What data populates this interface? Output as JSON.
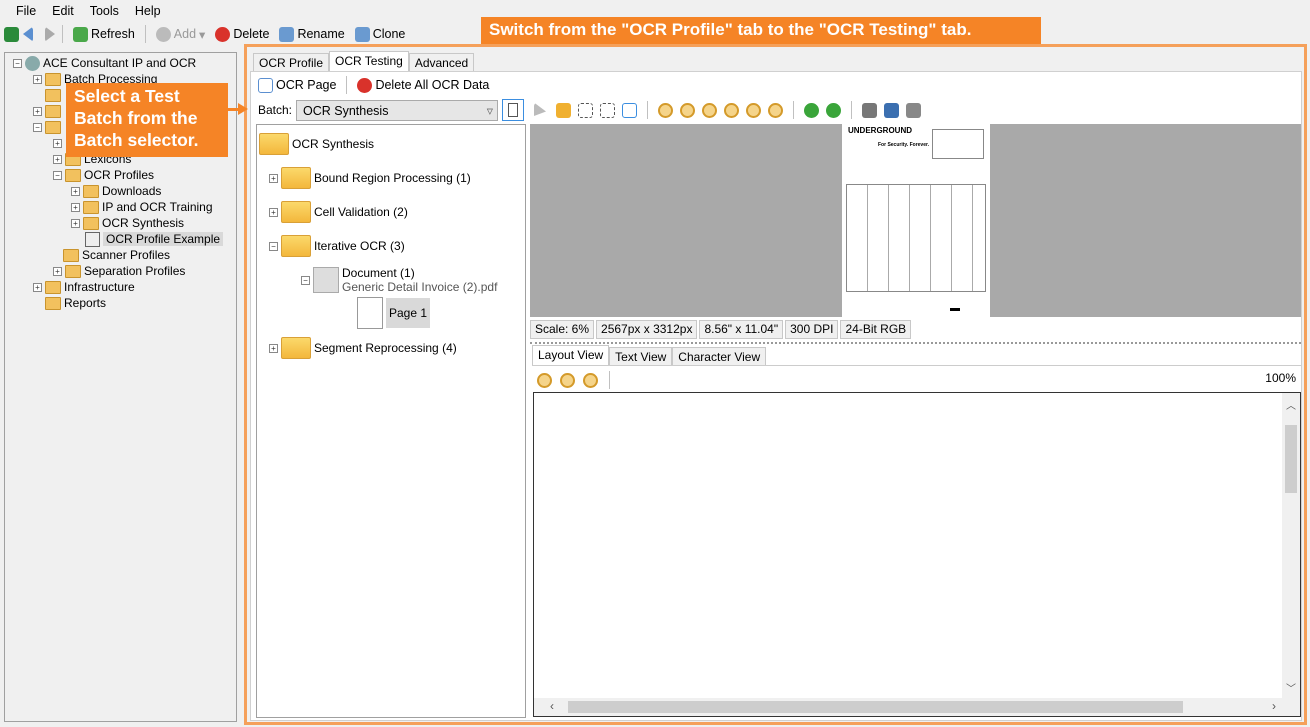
{
  "menu": [
    "File",
    "Edit",
    "Tools",
    "Help"
  ],
  "toolbar": {
    "refresh": "Refresh",
    "add": "Add",
    "delete": "Delete",
    "rename": "Rename",
    "clone": "Clone"
  },
  "tree": {
    "root": "ACE Consultant IP and OCR",
    "items": [
      "Batch Processing",
      "Lexicons",
      "OCR Profiles",
      "Downloads",
      "IP and OCR Training",
      "OCR Synthesis",
      "OCR Profile Example",
      "Scanner Profiles",
      "Separation Profiles",
      "Infrastructure",
      "Reports"
    ]
  },
  "callouts": {
    "top": "Switch from the \"OCR Profile\" tab to the \"OCR Testing\" tab.",
    "left": "Select a Test Batch from the Batch selector."
  },
  "tabs": [
    "OCR Profile",
    "OCR Testing",
    "Advanced"
  ],
  "active_tab": "OCR Testing",
  "ocr_toolbar": {
    "ocr_page": "OCR Page",
    "delete_all": "Delete All OCR Data"
  },
  "batch": {
    "label": "Batch:",
    "value": "OCR Synthesis"
  },
  "batch_tree": {
    "root": "OCR Synthesis",
    "folders": [
      "Bound Region Processing (1)",
      "Cell Validation (2)",
      "Iterative OCR (3)",
      "Segment Reprocessing (4)"
    ],
    "document": "Document (1)",
    "file": "Generic Detail Invoice (2).pdf",
    "page": "Page 1"
  },
  "status": [
    "Scale: 6%",
    "2567px x 3312px",
    "8.56\" x 11.04\"",
    "300 DPI",
    "24-Bit RGB"
  ],
  "view_tabs": [
    "Layout View",
    "Text View",
    "Character View"
  ],
  "zoom_level": "100%",
  "page_preview": {
    "logo": "UNDERGROUND",
    "tagline": "For Security. Forever."
  },
  "colors": {
    "callout": "#f58426",
    "highlight_border": "#f5a05a"
  }
}
